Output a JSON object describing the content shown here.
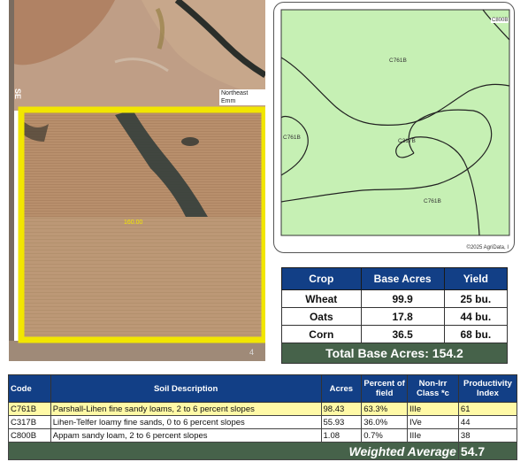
{
  "aerial": {
    "road_label": "Northeast Emm",
    "side_label": "SE",
    "field_acres_label": "160.00",
    "corner_number": "4"
  },
  "soil_map": {
    "labels": {
      "c761b_north": "C761B",
      "c761b_west": "C761B",
      "c317b": "C317B",
      "c761b_south": "C761B",
      "c800b": "C800B"
    },
    "fill_color": "#c6f0b4",
    "copyright": "©2025 AgriData, I"
  },
  "crop_table": {
    "headers": [
      "Crop",
      "Base Acres",
      "Yield"
    ],
    "rows": [
      {
        "crop": "Wheat",
        "base_acres": "99.9",
        "yield": "25 bu."
      },
      {
        "crop": "Oats",
        "base_acres": "17.8",
        "yield": "44 bu."
      },
      {
        "crop": "Corn",
        "base_acres": "36.5",
        "yield": "68 bu."
      }
    ],
    "total_label": "Total Base Acres:",
    "total_value": "154.2"
  },
  "soil_table": {
    "headers": [
      "Code",
      "Soil Description",
      "Acres",
      "Percent of field",
      "Non-Irr Class *c",
      "Productivity Index"
    ],
    "rows": [
      {
        "code": "C761B",
        "description": "Parshall-Lihen fine sandy loams, 2 to 6 percent slopes",
        "acres": "98.43",
        "percent": "63.3%",
        "class": "IIIe",
        "index": "61"
      },
      {
        "code": "C317B",
        "description": "Lihen-Telfer loamy fine sands, 0 to 6 percent slopes",
        "acres": "55.93",
        "percent": "36.0%",
        "class": "IVe",
        "index": "44"
      },
      {
        "code": "C800B",
        "description": "Appam sandy loam, 2 to 6 percent slopes",
        "acres": "1.08",
        "percent": "0.7%",
        "class": "IIIe",
        "index": "38"
      }
    ],
    "weighted_label": "Weighted Average",
    "weighted_value": "54.7"
  },
  "colors": {
    "header_blue": "#123f86",
    "total_green": "#46624a",
    "highlight_yellow": "#fff9a6",
    "boundary_yellow": "#f2e600"
  }
}
